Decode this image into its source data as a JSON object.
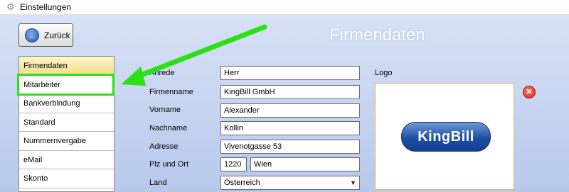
{
  "window": {
    "title": "Einstellungen",
    "icon": "gear-icon"
  },
  "header": {
    "back_label": "Zurück",
    "page_title": "Firmendaten"
  },
  "sidebar": {
    "items": [
      {
        "label": "Firmendaten",
        "active": true
      },
      {
        "label": "Mitarbeiter",
        "highlighted": true
      },
      {
        "label": "Bankverbindung"
      },
      {
        "label": "Standard"
      },
      {
        "label": "Nummernvergabe"
      },
      {
        "label": "eMail"
      },
      {
        "label": "Skonto"
      }
    ]
  },
  "form": {
    "anrede": {
      "label": "Anrede",
      "value": "Herr"
    },
    "firmenname": {
      "label": "Firmenname",
      "value": "KingBill GmbH"
    },
    "vorname": {
      "label": "Vorname",
      "value": "Alexander"
    },
    "nachname": {
      "label": "Nachname",
      "value": "Kollin"
    },
    "adresse": {
      "label": "Adresse",
      "value": "Vivenotgasse 53"
    },
    "plz_ort": {
      "label": "Plz und Ort",
      "plz": "1220",
      "ort": "Wien"
    },
    "land": {
      "label": "Land",
      "value": "Österreich"
    }
  },
  "logo": {
    "label": "Logo",
    "brand_text": "KingBill"
  },
  "colors": {
    "highlight": "#2be014",
    "accent": "#2b5bb8",
    "remove": "#d6221a"
  }
}
